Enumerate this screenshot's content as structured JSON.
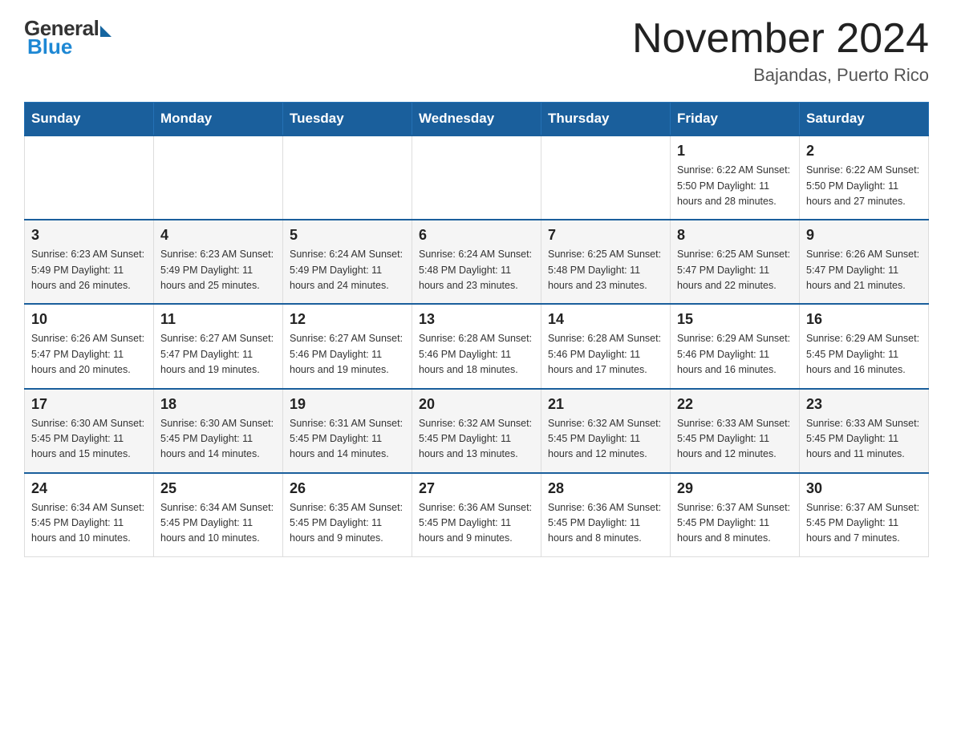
{
  "header": {
    "logo": {
      "general": "General",
      "blue": "Blue"
    },
    "title": "November 2024",
    "location": "Bajandas, Puerto Rico"
  },
  "weekdays": [
    "Sunday",
    "Monday",
    "Tuesday",
    "Wednesday",
    "Thursday",
    "Friday",
    "Saturday"
  ],
  "weeks": [
    [
      {
        "day": "",
        "info": ""
      },
      {
        "day": "",
        "info": ""
      },
      {
        "day": "",
        "info": ""
      },
      {
        "day": "",
        "info": ""
      },
      {
        "day": "",
        "info": ""
      },
      {
        "day": "1",
        "info": "Sunrise: 6:22 AM\nSunset: 5:50 PM\nDaylight: 11 hours and 28 minutes."
      },
      {
        "day": "2",
        "info": "Sunrise: 6:22 AM\nSunset: 5:50 PM\nDaylight: 11 hours and 27 minutes."
      }
    ],
    [
      {
        "day": "3",
        "info": "Sunrise: 6:23 AM\nSunset: 5:49 PM\nDaylight: 11 hours and 26 minutes."
      },
      {
        "day": "4",
        "info": "Sunrise: 6:23 AM\nSunset: 5:49 PM\nDaylight: 11 hours and 25 minutes."
      },
      {
        "day": "5",
        "info": "Sunrise: 6:24 AM\nSunset: 5:49 PM\nDaylight: 11 hours and 24 minutes."
      },
      {
        "day": "6",
        "info": "Sunrise: 6:24 AM\nSunset: 5:48 PM\nDaylight: 11 hours and 23 minutes."
      },
      {
        "day": "7",
        "info": "Sunrise: 6:25 AM\nSunset: 5:48 PM\nDaylight: 11 hours and 23 minutes."
      },
      {
        "day": "8",
        "info": "Sunrise: 6:25 AM\nSunset: 5:47 PM\nDaylight: 11 hours and 22 minutes."
      },
      {
        "day": "9",
        "info": "Sunrise: 6:26 AM\nSunset: 5:47 PM\nDaylight: 11 hours and 21 minutes."
      }
    ],
    [
      {
        "day": "10",
        "info": "Sunrise: 6:26 AM\nSunset: 5:47 PM\nDaylight: 11 hours and 20 minutes."
      },
      {
        "day": "11",
        "info": "Sunrise: 6:27 AM\nSunset: 5:47 PM\nDaylight: 11 hours and 19 minutes."
      },
      {
        "day": "12",
        "info": "Sunrise: 6:27 AM\nSunset: 5:46 PM\nDaylight: 11 hours and 19 minutes."
      },
      {
        "day": "13",
        "info": "Sunrise: 6:28 AM\nSunset: 5:46 PM\nDaylight: 11 hours and 18 minutes."
      },
      {
        "day": "14",
        "info": "Sunrise: 6:28 AM\nSunset: 5:46 PM\nDaylight: 11 hours and 17 minutes."
      },
      {
        "day": "15",
        "info": "Sunrise: 6:29 AM\nSunset: 5:46 PM\nDaylight: 11 hours and 16 minutes."
      },
      {
        "day": "16",
        "info": "Sunrise: 6:29 AM\nSunset: 5:45 PM\nDaylight: 11 hours and 16 minutes."
      }
    ],
    [
      {
        "day": "17",
        "info": "Sunrise: 6:30 AM\nSunset: 5:45 PM\nDaylight: 11 hours and 15 minutes."
      },
      {
        "day": "18",
        "info": "Sunrise: 6:30 AM\nSunset: 5:45 PM\nDaylight: 11 hours and 14 minutes."
      },
      {
        "day": "19",
        "info": "Sunrise: 6:31 AM\nSunset: 5:45 PM\nDaylight: 11 hours and 14 minutes."
      },
      {
        "day": "20",
        "info": "Sunrise: 6:32 AM\nSunset: 5:45 PM\nDaylight: 11 hours and 13 minutes."
      },
      {
        "day": "21",
        "info": "Sunrise: 6:32 AM\nSunset: 5:45 PM\nDaylight: 11 hours and 12 minutes."
      },
      {
        "day": "22",
        "info": "Sunrise: 6:33 AM\nSunset: 5:45 PM\nDaylight: 11 hours and 12 minutes."
      },
      {
        "day": "23",
        "info": "Sunrise: 6:33 AM\nSunset: 5:45 PM\nDaylight: 11 hours and 11 minutes."
      }
    ],
    [
      {
        "day": "24",
        "info": "Sunrise: 6:34 AM\nSunset: 5:45 PM\nDaylight: 11 hours and 10 minutes."
      },
      {
        "day": "25",
        "info": "Sunrise: 6:34 AM\nSunset: 5:45 PM\nDaylight: 11 hours and 10 minutes."
      },
      {
        "day": "26",
        "info": "Sunrise: 6:35 AM\nSunset: 5:45 PM\nDaylight: 11 hours and 9 minutes."
      },
      {
        "day": "27",
        "info": "Sunrise: 6:36 AM\nSunset: 5:45 PM\nDaylight: 11 hours and 9 minutes."
      },
      {
        "day": "28",
        "info": "Sunrise: 6:36 AM\nSunset: 5:45 PM\nDaylight: 11 hours and 8 minutes."
      },
      {
        "day": "29",
        "info": "Sunrise: 6:37 AM\nSunset: 5:45 PM\nDaylight: 11 hours and 8 minutes."
      },
      {
        "day": "30",
        "info": "Sunrise: 6:37 AM\nSunset: 5:45 PM\nDaylight: 11 hours and 7 minutes."
      }
    ]
  ]
}
